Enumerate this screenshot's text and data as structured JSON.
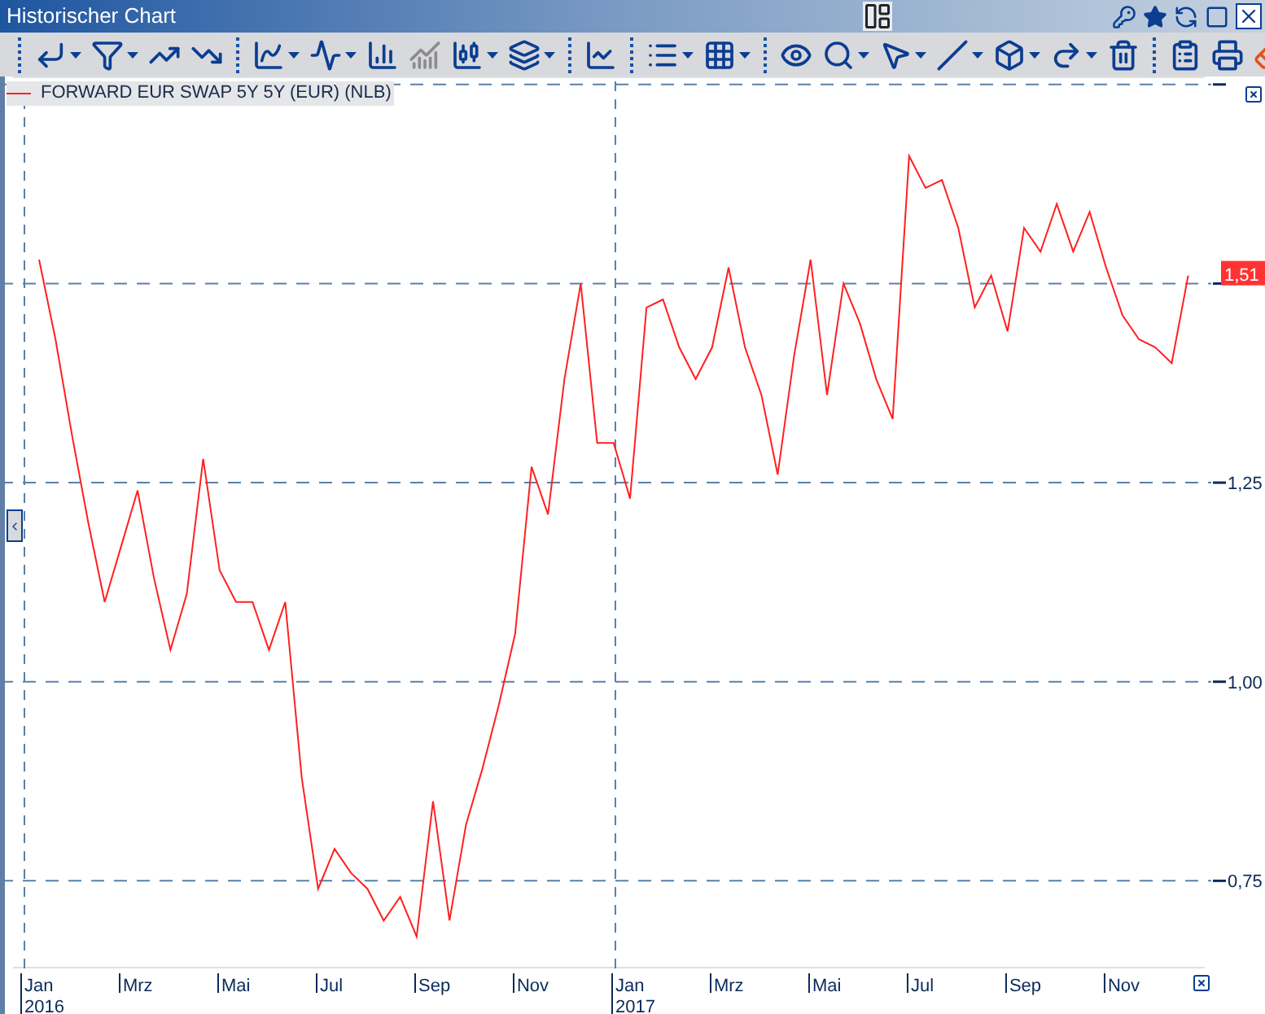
{
  "window": {
    "title": "Historischer Chart"
  },
  "last_value": "1,51",
  "chart_data": {
    "type": "line",
    "grid": true,
    "ylim": [
      0.64,
      1.76
    ],
    "categories": [
      "Jan 2016",
      null,
      null,
      null,
      null,
      null,
      "Mrz",
      null,
      null,
      null,
      null,
      null,
      "Mai",
      null,
      null,
      null,
      null,
      null,
      "Jul",
      null,
      null,
      null,
      null,
      null,
      "Sep",
      null,
      null,
      null,
      null,
      null,
      "Nov",
      null,
      null,
      null,
      null,
      null,
      "Jan 2017",
      null,
      null,
      null,
      null,
      null,
      "Mrz",
      null,
      null,
      null,
      null,
      null,
      "Mai",
      null,
      null,
      null,
      null,
      null,
      "Jul",
      null,
      null,
      null,
      null,
      null,
      "Sep",
      null,
      null,
      null,
      null,
      null,
      "Nov",
      null,
      null,
      null,
      null
    ],
    "yticks": [
      {
        "value": 0.75,
        "label": "0,75"
      },
      {
        "value": 1.0,
        "label": "1,00"
      },
      {
        "value": 1.25,
        "label": "1,25"
      }
    ],
    "series": [
      {
        "name": "FORWARD EUR SWAP 5Y 5Y (EUR) (NLB)",
        "color": "#ff2020",
        "values": [
          1.53,
          1.43,
          1.31,
          1.2,
          1.1,
          1.17,
          1.24,
          1.13,
          1.04,
          1.11,
          1.28,
          1.14,
          1.1,
          1.1,
          1.04,
          1.1,
          0.88,
          0.74,
          0.79,
          0.76,
          0.74,
          0.7,
          0.73,
          0.68,
          0.85,
          0.7,
          0.82,
          0.89,
          0.97,
          1.06,
          1.27,
          1.21,
          1.38,
          1.5,
          1.3,
          1.3,
          1.23,
          1.47,
          1.48,
          1.42,
          1.38,
          1.42,
          1.52,
          1.42,
          1.36,
          1.26,
          1.41,
          1.53,
          1.36,
          1.5,
          1.45,
          1.38,
          1.33,
          1.66,
          1.62,
          1.63,
          1.57,
          1.47,
          1.51,
          1.44,
          1.57,
          1.54,
          1.6,
          1.54,
          1.59,
          1.52,
          1.46,
          1.43,
          1.42,
          1.4,
          1.51
        ]
      }
    ]
  }
}
